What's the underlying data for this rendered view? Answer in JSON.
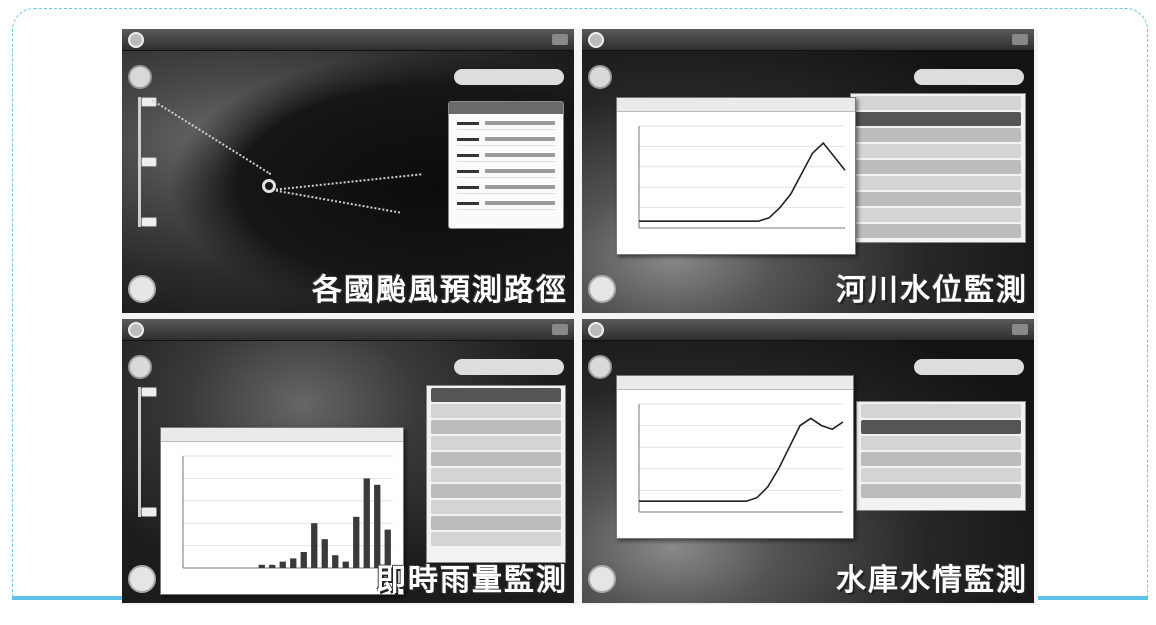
{
  "captions": {
    "typhoon": "各國颱風預測路徑",
    "river": "河川水位監測",
    "rain": "即時雨量監測",
    "reservoir": "水庫水情監測"
  },
  "colors": {
    "frame_border": "#6fc6e6",
    "bottom_rule": "#5cc2e8",
    "caption_text": "#ffffff"
  },
  "icons": [
    "logo-icon",
    "zoom-in-icon",
    "zoom-out-icon",
    "compass-icon",
    "close-icon"
  ],
  "chart_data": [
    {
      "type": "line",
      "x": [
        0,
        1,
        2,
        3,
        4,
        5,
        6,
        7,
        8,
        9,
        10,
        11,
        12,
        13,
        14,
        15,
        16,
        17,
        18,
        19
      ],
      "series": [
        {
          "values": [
            2,
            2,
            2,
            2,
            2,
            2,
            2,
            2,
            2,
            2,
            2,
            2,
            3,
            6,
            10,
            16,
            22,
            25,
            21,
            17
          ]
        }
      ],
      "ylim": [
        0,
        30
      ],
      "grid": true
    },
    {
      "type": "bar",
      "x": [
        0,
        1,
        2,
        3,
        4,
        5,
        6,
        7,
        8,
        9,
        10,
        11,
        12,
        13,
        14,
        15,
        16,
        17,
        18,
        19
      ],
      "values": [
        0,
        0,
        0,
        0,
        0,
        0,
        0,
        1,
        1,
        2,
        3,
        5,
        14,
        9,
        4,
        2,
        16,
        28,
        26,
        12
      ],
      "ylim": [
        0,
        35
      ],
      "grid": true
    },
    {
      "type": "line",
      "x": [
        0,
        1,
        2,
        3,
        4,
        5,
        6,
        7,
        8,
        9,
        10,
        11,
        12,
        13,
        14,
        15,
        16,
        17,
        18,
        19
      ],
      "series": [
        {
          "values": [
            3,
            3,
            3,
            3,
            3,
            3,
            3,
            3,
            3,
            3,
            3,
            4,
            7,
            12,
            18,
            24,
            26,
            24,
            23,
            25
          ]
        }
      ],
      "ylim": [
        0,
        30
      ],
      "grid": true
    }
  ]
}
